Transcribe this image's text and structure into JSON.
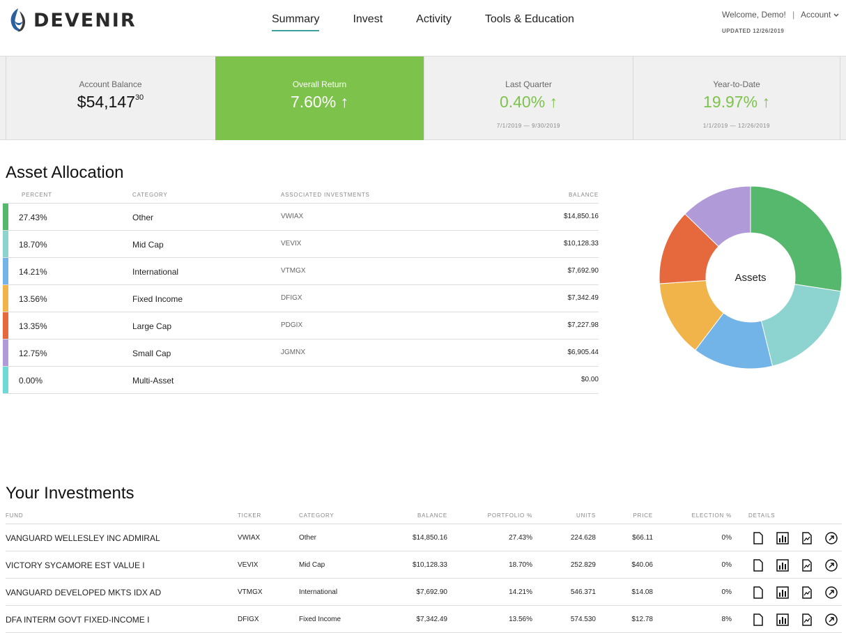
{
  "brand": {
    "name": "DEVENIR"
  },
  "nav": {
    "items": [
      {
        "label": "Summary",
        "active": true
      },
      {
        "label": "Invest",
        "active": false
      },
      {
        "label": "Activity",
        "active": false
      },
      {
        "label": "Tools & Education",
        "active": false
      }
    ]
  },
  "user": {
    "welcome": "Welcome, Demo!",
    "separator": "|",
    "account": "Account",
    "updated": "UPDATED 12/26/2019"
  },
  "stats": {
    "balance": {
      "label": "Account Balance",
      "value": "$54,147",
      "cents": "30"
    },
    "overall": {
      "label": "Overall Return",
      "value": "7.60% ↑"
    },
    "quarter": {
      "label": "Last Quarter",
      "value": "0.40% ↑",
      "range": "7/1/2019 — 9/30/2019"
    },
    "ytd": {
      "label": "Year-to-Date",
      "value": "19.97% ↑",
      "range": "1/1/2019 — 12/26/2019"
    }
  },
  "allocation": {
    "title": "Asset Allocation",
    "headers": {
      "percent": "PERCENT",
      "category": "CATEGORY",
      "investments": "ASSOCIATED INVESTMENTS",
      "balance": "BALANCE"
    },
    "rows": [
      {
        "percent": "27.43%",
        "category": "Other",
        "investments": "VWIAX",
        "balance": "$14,850.16",
        "color": "#56b86c"
      },
      {
        "percent": "18.70%",
        "category": "Mid Cap",
        "investments": "VEVIX",
        "balance": "$10,128.33",
        "color": "#8dd4d0"
      },
      {
        "percent": "14.21%",
        "category": "International",
        "investments": "VTMGX",
        "balance": "$7,692.90",
        "color": "#72b4e8"
      },
      {
        "percent": "13.56%",
        "category": "Fixed Income",
        "investments": "DFIGX",
        "balance": "$7,342.49",
        "color": "#f0b44a"
      },
      {
        "percent": "13.35%",
        "category": "Large Cap",
        "investments": "PDGIX",
        "balance": "$7,227.98",
        "color": "#e5693c"
      },
      {
        "percent": "12.75%",
        "category": "Small Cap",
        "investments": "JGMNX",
        "balance": "$6,905.44",
        "color": "#b09ad8"
      },
      {
        "percent": "0.00%",
        "category": "Multi-Asset",
        "investments": "",
        "balance": "$0.00",
        "color": "#6fdad8"
      }
    ],
    "donut_label": "Assets"
  },
  "investments": {
    "title": "Your Investments",
    "headers": {
      "fund": "FUND",
      "ticker": "TICKER",
      "category": "CATEGORY",
      "balance": "BALANCE",
      "portfolio": "PORTFOLIO %",
      "units": "UNITS",
      "price": "PRICE",
      "election": "ELECTION %",
      "details": "DETAILS"
    },
    "rows": [
      {
        "fund": "VANGUARD WELLESLEY INC ADMIRAL",
        "ticker": "VWIAX",
        "category": "Other",
        "balance": "$14,850.16",
        "portfolio": "27.43%",
        "units": "224.628",
        "price": "$66.11",
        "election": "0%"
      },
      {
        "fund": "VICTORY SYCAMORE EST VALUE I",
        "ticker": "VEVIX",
        "category": "Mid Cap",
        "balance": "$10,128.33",
        "portfolio": "18.70%",
        "units": "252.829",
        "price": "$40.06",
        "election": "0%"
      },
      {
        "fund": "VANGUARD DEVELOPED MKTS IDX AD",
        "ticker": "VTMGX",
        "category": "International",
        "balance": "$7,692.90",
        "portfolio": "14.21%",
        "units": "546.371",
        "price": "$14.08",
        "election": "0%"
      },
      {
        "fund": "DFA INTERM GOVT FIXED-INCOME I",
        "ticker": "DFIGX",
        "category": "Fixed Income",
        "balance": "$7,342.49",
        "portfolio": "13.56%",
        "units": "574.530",
        "price": "$12.78",
        "election": "8%"
      }
    ]
  }
}
